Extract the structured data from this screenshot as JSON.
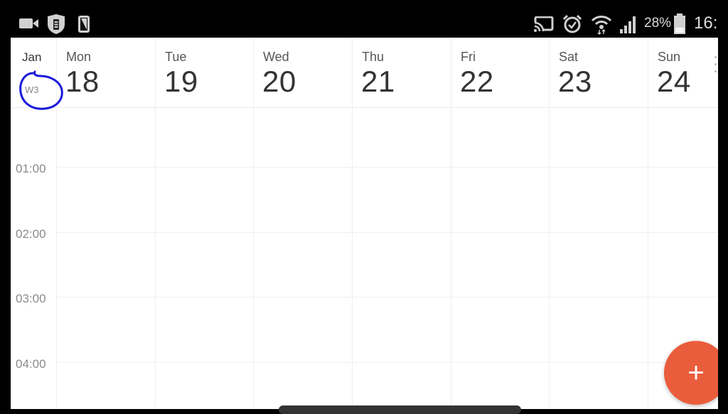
{
  "status_bar": {
    "left_icons": [
      "video-camera-icon",
      "shield-battery-icon",
      "screen-rotate-icon"
    ],
    "right_icons": [
      "cast-icon",
      "alarm-icon",
      "wifi-icon",
      "signal-icon"
    ],
    "battery_percent": "28%",
    "battery_level": 0.28,
    "time": "16:"
  },
  "calendar": {
    "month": "Jan",
    "week": "W3",
    "days": [
      {
        "name": "Mon",
        "date": "18"
      },
      {
        "name": "Tue",
        "date": "19"
      },
      {
        "name": "Wed",
        "date": "20"
      },
      {
        "name": "Thu",
        "date": "21"
      },
      {
        "name": "Fri",
        "date": "22"
      },
      {
        "name": "Sat",
        "date": "23"
      },
      {
        "name": "Sun",
        "date": "24"
      }
    ],
    "hours": [
      "01:00",
      "02:00",
      "03:00",
      "04:00"
    ]
  },
  "fab": {
    "label": "+",
    "icon": "plus-icon"
  },
  "colors": {
    "fab": "#ea5d3c",
    "annotation": "#1a1adb"
  }
}
